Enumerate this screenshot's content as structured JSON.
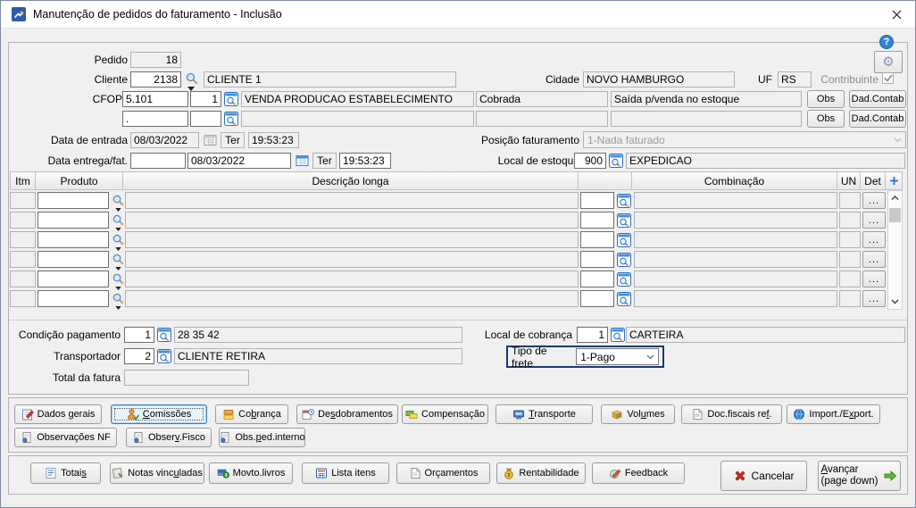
{
  "window": {
    "title": "Manutenção de pedidos do faturamento - Inclusão"
  },
  "colors": {
    "focus_outline": "#1d3a6d",
    "lookup_blue": "#2b6fc0",
    "help_blue": "#2f86d2"
  },
  "form": {
    "pedido": {
      "label": "Pedido",
      "value": "18"
    },
    "cliente": {
      "label": "Cliente",
      "code": "2138",
      "name": "CLIENTE 1"
    },
    "cidade": {
      "label": "Cidade",
      "value": "NOVO HAMBURGO"
    },
    "uf": {
      "label": "UF",
      "value": "RS"
    },
    "contribuinte": {
      "label": "Contribuinte",
      "checked": true
    },
    "cfops": {
      "label": "CFOPs",
      "obs_label": "Obs",
      "dadcontab_label": "Dad.Contab",
      "rows": [
        {
          "code": "5.101",
          "seq": "1",
          "descricao": "VENDA PRODUCAO ESTABELECIMENTO",
          "cobrada": "Cobrada",
          "estoque": "Saída p/venda no estoque"
        },
        {
          "code": ".",
          "seq": "",
          "descricao": "",
          "cobrada": "",
          "estoque": ""
        }
      ]
    },
    "data_entrada": {
      "label": "Data de entrada",
      "date": "08/03/2022",
      "weekday": "Ter",
      "time": "19:53:23"
    },
    "posicao_faturamento": {
      "label": "Posição faturamento",
      "value": "1-Nada faturado"
    },
    "data_entrega": {
      "label": "Data entrega/fat.",
      "extra": "",
      "date": "08/03/2022",
      "weekday": "Ter",
      "time": "19:53:23"
    },
    "local_estoque": {
      "label": "Local de estoque",
      "code": "900",
      "name": "EXPEDICAO"
    }
  },
  "items_table": {
    "headers": {
      "itm": "Itm",
      "produto": "Produto",
      "descricao": "Descrição longa",
      "combinacao": "Combinação",
      "un": "UN",
      "det": "Det"
    },
    "row_count": 6,
    "det_button": "..."
  },
  "payment": {
    "condicao": {
      "label": "Condição pagamento",
      "code": "1",
      "name": "28 35 42"
    },
    "local_cobranca": {
      "label": "Local de cobrança",
      "code": "1",
      "name": "CARTEIRA"
    },
    "transportador": {
      "label": "Transportador",
      "code": "2",
      "name": "CLIENTE RETIRA"
    },
    "tipo_frete": {
      "label": "Tipo de frete",
      "value": "1-Pago"
    },
    "total_fatura": {
      "label": "Total da fatura",
      "value": ""
    }
  },
  "tabs": {
    "row1": [
      {
        "label": "Dados gerais",
        "accel_index": 6,
        "icon": "notepad-pencil-icon"
      },
      {
        "label": "Comissões",
        "accel_index": 0,
        "icon": "person-check-icon",
        "focused": true
      },
      {
        "label": "Cobrança",
        "accel_index": 2,
        "icon": "billing-icon"
      },
      {
        "label": "Desdobramentos",
        "accel_index": 2,
        "icon": "calendar-clock-icon"
      },
      {
        "label": "Compensação",
        "accel_index": -1,
        "icon": "money-exchange-icon"
      },
      {
        "label": "Transporte",
        "accel_index": 0,
        "icon": "transport-icon"
      },
      {
        "label": "Volumes",
        "accel_index": 3,
        "icon": "box-icon"
      },
      {
        "label": "Doc.fiscais ref.",
        "accel_index": 14,
        "icon": "document-icon"
      },
      {
        "label": "Import./Export.",
        "accel_index": 9,
        "icon": "globe-icon"
      }
    ],
    "row2": [
      {
        "label": "Observações NF",
        "accel_index": -1,
        "icon": "note-icon"
      },
      {
        "label": "Observ.Fisco",
        "accel_index": 5,
        "icon": "note-icon"
      },
      {
        "label": "Obs.ped.interno",
        "accel_index": 4,
        "icon": "note-icon"
      }
    ]
  },
  "bottom_bar": {
    "buttons": [
      {
        "label": "Totais",
        "accel_index": 5,
        "icon": "totals-icon"
      },
      {
        "label": "Notas vinculadas",
        "accel_index": 10,
        "icon": "linked-notes-icon"
      },
      {
        "label": "Movto.livros",
        "accel_index": -1,
        "icon": "money-books-icon"
      },
      {
        "label": "Lista itens",
        "accel_index": -1,
        "icon": "list-calc-icon"
      },
      {
        "label": "Orçamentos",
        "accel_index": -1,
        "icon": "document-icon"
      },
      {
        "label": "Rentabilidade",
        "accel_index": -1,
        "icon": "money-bag-icon"
      },
      {
        "label": "Feedback",
        "accel_index": -1,
        "icon": "feedback-pencil-icon"
      }
    ],
    "cancel": {
      "label": "Cancelar",
      "icon": "cancel-x-icon"
    },
    "advance": {
      "label": "Avançar",
      "sublabel": "(page down)",
      "accel_index": 0,
      "icon": "green-arrow-icon"
    }
  }
}
